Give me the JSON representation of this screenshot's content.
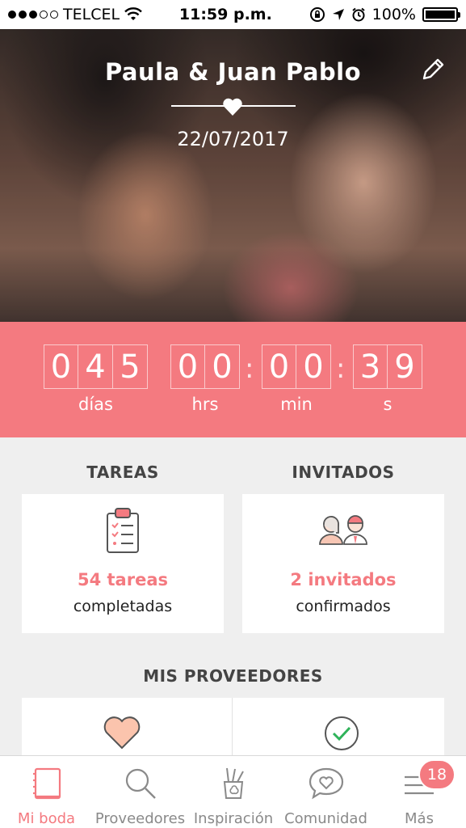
{
  "status_bar": {
    "carrier": "TELCEL",
    "time": "11:59 p.m.",
    "battery": "100%"
  },
  "hero": {
    "couple_name": "Paula & Juan Pablo",
    "date": "22/07/2017"
  },
  "countdown": {
    "days": [
      "0",
      "4",
      "5"
    ],
    "hours": [
      "0",
      "0"
    ],
    "minutes": [
      "0",
      "0"
    ],
    "seconds": [
      "3",
      "9"
    ],
    "labels": {
      "days": "días",
      "hours": "hrs",
      "minutes": "min",
      "seconds": "s"
    }
  },
  "tasks": {
    "title": "TAREAS",
    "count": "54 tareas",
    "subtitle": "completadas"
  },
  "guests": {
    "title": "INVITADOS",
    "count": "2 invitados",
    "subtitle": "confirmados"
  },
  "vendors": {
    "title": "MIS PROVEEDORES"
  },
  "tabbar": {
    "items": [
      {
        "label": "Mi boda",
        "icon": "notebook-icon"
      },
      {
        "label": "Proveedores",
        "icon": "search-icon"
      },
      {
        "label": "Inspiración",
        "icon": "pencil-cup-icon"
      },
      {
        "label": "Comunidad",
        "icon": "chat-heart-icon"
      },
      {
        "label": "Más",
        "icon": "menu-icon",
        "badge": "18"
      }
    ]
  },
  "colors": {
    "accent": "#f47a80",
    "background": "#efefef",
    "success": "#2fb35a"
  }
}
